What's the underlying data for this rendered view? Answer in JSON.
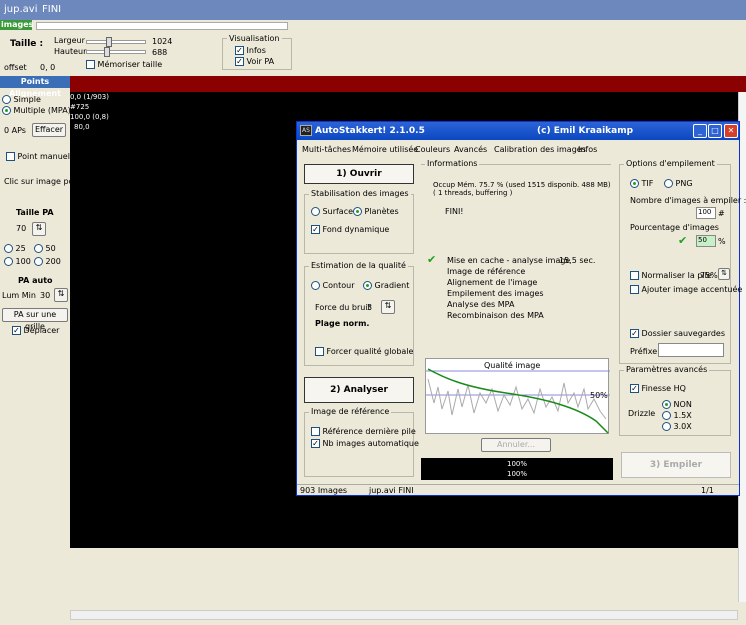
{
  "window": {
    "title": "jup.avi",
    "status": "FINI"
  },
  "top": {
    "images_tab": "images",
    "taille_label": "Taille :",
    "largeur_label": "Largeur",
    "largeur_value": "1024",
    "hauteur_label": "Hauteur",
    "hauteur_value": "688",
    "memoriser_label": "Mémoriser taille",
    "offset_label": "offset",
    "offset_value": "0, 0",
    "visualisation": {
      "title": "Visualisation",
      "infos": "Infos",
      "voir_pa": "Voir PA"
    }
  },
  "left": {
    "title": "Points Alignement",
    "simple": "Simple",
    "multiple": "Multiple (MPA)",
    "aps": "0 APs",
    "effacer": "Effacer",
    "point_manuel": "Point manuel",
    "clic": "Clic sur image pour",
    "taille_pa": "Taille PA",
    "taille_value": "70",
    "r25": "25",
    "r50": "50",
    "r100": "100",
    "r200": "200",
    "pa_auto": "PA auto",
    "lum_min": "Lum Min",
    "lum_value": "30",
    "pa_grille": "PA sur une grille",
    "deplacer": "Déplacer"
  },
  "overlay": {
    "line1": "0,0 (1/903) #725",
    "line2": "100,0  (0,8)",
    "line3": "80,0"
  },
  "dialog": {
    "title": "AutoStakkert! 2.1.0.5",
    "copyright": "(c) Emil Kraaikamp",
    "menu": [
      "Multi-tâches",
      "Mémoire utilisée",
      "Couleurs",
      "Avancés",
      "Calibration des images",
      "Infos"
    ],
    "ouvrir": "1) Ouvrir",
    "stab_title": "Stabilisation des images",
    "surface": "Surface",
    "planetes": "Planètes",
    "fond_dynamique": "Fond dynamique",
    "estim_title": "Estimation de la qualité",
    "contour": "Contour",
    "gradient": "Gradient",
    "force_bruit": "Force du bruit",
    "force_value": "3",
    "plage": "Plage norm.",
    "forcer_qualite": "Forcer qualité globale",
    "analyser": "2) Analyser",
    "ref_title": "Image de référence",
    "ref_derniere": "Référence dernière pile",
    "nb_images_auto": "Nb images automatique",
    "info_title": "Informations",
    "occup": "Occup Mém. 75.7 %  (used 1515 disponib. 488 MB)",
    "threads": "( 1 threads, buffering )",
    "fini": "FINI!",
    "steps": [
      {
        "label": "Mise en cache - analyse image",
        "time": "15,5 sec."
      },
      {
        "label": "Image de référence",
        "time": ""
      },
      {
        "label": "Alignement de l'image",
        "time": ""
      },
      {
        "label": "Empilement des images",
        "time": ""
      },
      {
        "label": "Analyse des MPA",
        "time": ""
      },
      {
        "label": "Recombinaison des MPA",
        "time": ""
      }
    ],
    "qualite_title": "Qualité image",
    "pct50": "50%",
    "annuler": "Annuler...",
    "bar1": "100%",
    "bar2": "100%",
    "options_title": "Options d'empilement",
    "tif": "TIF",
    "png": "PNG",
    "nb_images_label": "Nombre d'images à empiler :",
    "nb_images_value": "100",
    "hash": "#",
    "pourcentage_label": "Pourcentage d'images",
    "pourcentage_value": "50",
    "pct_sym": "%",
    "normaliser": "Normaliser la pile",
    "normaliser_value": "75%",
    "ajouter": "Ajouter image accentuée",
    "dossier": "Dossier sauvegardes",
    "prefixe": "Préfixe",
    "avances_title": "Paramètres avancés",
    "finesse": "Finesse HQ",
    "drizzle": "Drizzle",
    "non": "NON",
    "x15": "1.5X",
    "x30": "3.0X",
    "empiler": "3) Empiler",
    "status_count": "903 Images",
    "status_file": "jup.avi  FINI",
    "status_page": "1/1"
  },
  "colors": {
    "accent": "#0a48c0",
    "red_bar": "#8b0000",
    "green": "#21a121"
  }
}
